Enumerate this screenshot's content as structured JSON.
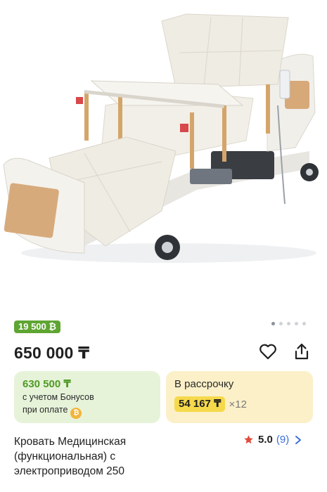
{
  "product": {
    "image_alt": "medical bed",
    "bonus_badge": "19 500 ₿",
    "price": "650 000 ₸",
    "bonus_card": {
      "price": "630 500 ₸",
      "line1": "с учетом Бонусов",
      "line2": "при оплате"
    },
    "installment_card": {
      "label": "В рассрочку",
      "monthly": "54 167 ₸",
      "times": "×12"
    },
    "title_lines": [
      "Кровать Медицинская",
      "(функциональная) с",
      "электроприводом 250"
    ],
    "rating": {
      "score": "5.0",
      "count": "(9)"
    }
  },
  "icons": {
    "favorite": "heart-icon",
    "share": "share-icon",
    "rating_star": "star-icon",
    "rating_more": "chevron-right-icon",
    "bonus_coin": "coin-icon"
  },
  "colors": {
    "bonus_green": "#5fa532",
    "bonus_card_bg": "#e6f3d9",
    "installment_card_bg": "#fbf0c8",
    "installment_price_bg": "#f6d94a",
    "star_red": "#e24a3b",
    "link_blue": "#3a6fd8"
  }
}
